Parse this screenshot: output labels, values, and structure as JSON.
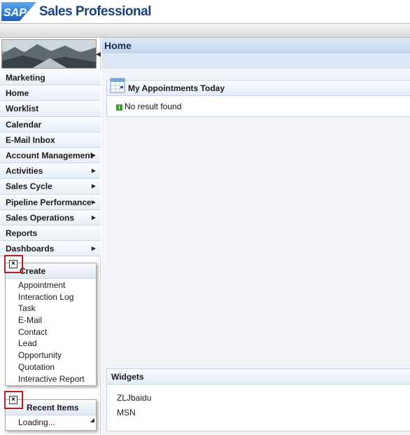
{
  "app": {
    "logo_text": "SAP",
    "title": "Sales Professional"
  },
  "nav": {
    "items": [
      {
        "label": "Marketing",
        "submenu": false
      },
      {
        "label": "Home",
        "submenu": false
      },
      {
        "label": "Worklist",
        "submenu": false
      },
      {
        "label": "Calendar",
        "submenu": false
      },
      {
        "label": "E-Mail Inbox",
        "submenu": false
      },
      {
        "label": "Account Management",
        "submenu": true
      },
      {
        "label": "Activities",
        "submenu": true
      },
      {
        "label": "Sales Cycle",
        "submenu": true
      },
      {
        "label": "Pipeline Performance",
        "submenu": true
      },
      {
        "label": "Sales Operations",
        "submenu": true
      },
      {
        "label": "Reports",
        "submenu": false
      },
      {
        "label": "Dashboards",
        "submenu": true
      }
    ],
    "create_menu": {
      "title": "Create",
      "items": [
        "Appointment",
        "Interaction Log",
        "Task",
        "E-Mail",
        "Contact",
        "Lead",
        "Opportunity",
        "Quotation",
        "Interactive Report"
      ]
    },
    "recent_menu": {
      "title": "Recent Items",
      "items": [
        "Loading..."
      ]
    }
  },
  "main": {
    "title": "Home",
    "appointments": {
      "title": "My Appointments Today",
      "empty_text": "No result found"
    },
    "widgets": {
      "title": "Widgets",
      "items": [
        "ZLJbaidu",
        "MSN"
      ]
    }
  },
  "colors": {
    "brand_blue": "#1a3f7a",
    "sap_logo": "#1f6fd0",
    "highlight_red": "#b22222"
  },
  "icons": [
    "sap-logo",
    "nav-collapse-arrow",
    "chevron-right-icon",
    "calendar-icon",
    "info-icon",
    "close-icon",
    "resize-corner-icon"
  ]
}
